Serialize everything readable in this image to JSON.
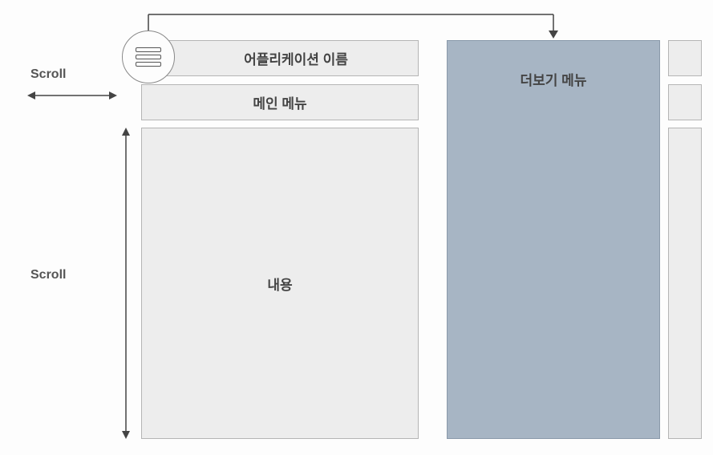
{
  "labels": {
    "scroll_h": "Scroll",
    "scroll_v": "Scroll"
  },
  "panels": {
    "app_name": "어플리케이션 이름",
    "main_menu": "메인 메뉴",
    "content": "내용",
    "more_menu": "더보기 메뉴"
  },
  "icons": {
    "menu": "hamburger-menu-icon"
  }
}
